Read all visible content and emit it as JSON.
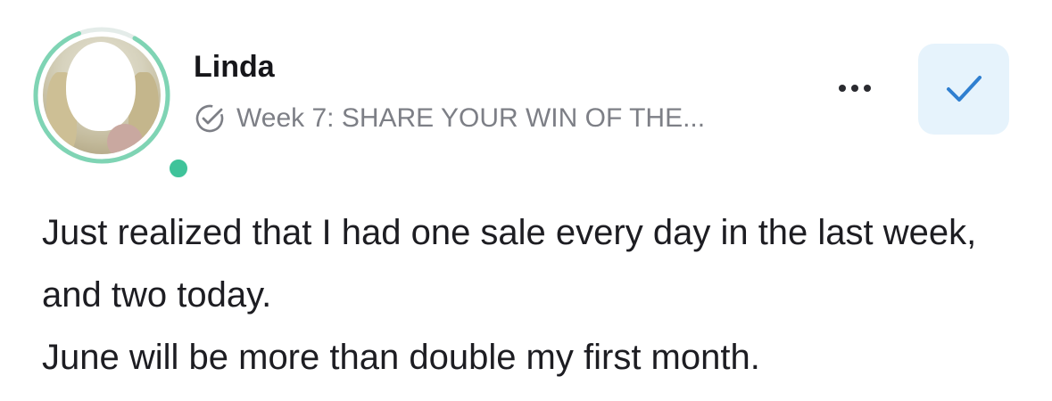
{
  "author": {
    "name": "Linda",
    "online": true
  },
  "post": {
    "topic": "Week 7: SHARE YOUR WIN OF THE...",
    "body_paragraphs": [
      "Just realized that I had one sale every day in the last week, and two today.",
      "June will be more than double my first month."
    ]
  },
  "actions": {
    "more_icon": "more-horizontal-icon",
    "check_icon": "checkmark-icon",
    "topic_icon": "check-circle-icon"
  },
  "colors": {
    "avatar_ring": "#7fd4b4",
    "online_dot": "#3fc39a",
    "check_button_bg": "#e6f3fc",
    "check_mark": "#2f7fd0",
    "meta_text": "#7d7f86"
  }
}
